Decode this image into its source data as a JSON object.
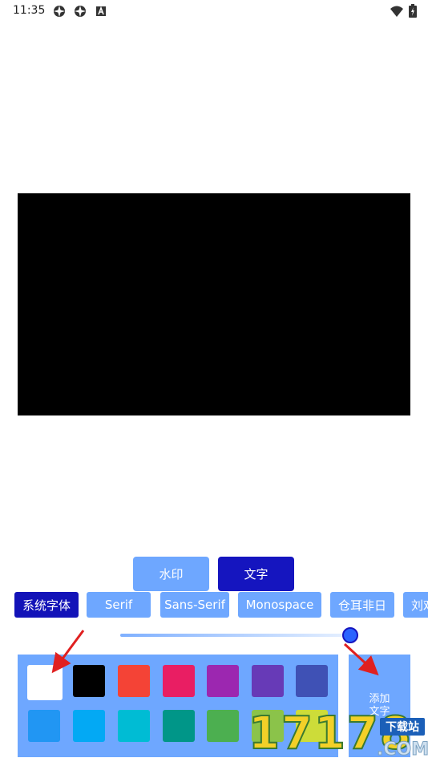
{
  "status_bar": {
    "time": "11:35"
  },
  "tabs": [
    {
      "label": "水印"
    },
    {
      "label": "文字"
    }
  ],
  "fonts": [
    {
      "label": "系统字体",
      "selected": true
    },
    {
      "label": "Serif"
    },
    {
      "label": "Sans-Serif"
    },
    {
      "label": "Monospace"
    },
    {
      "label": "仓耳非日"
    },
    {
      "label": "刘戏"
    }
  ],
  "size_slider": {
    "value_fraction": 1.0
  },
  "colors": {
    "row1": [
      "#ffffff",
      "#000000",
      "#f44336",
      "#e91e63",
      "#9c27b0",
      "#673ab7",
      "#3f51b5"
    ],
    "row2": [
      "#2196f3",
      "#03a9f4",
      "#00bcd4",
      "#009688",
      "#4caf50",
      "#8bc34a",
      "#cddc39"
    ],
    "accent": "#6ea7ff",
    "selected_tab": "#1515bf"
  },
  "add_button": {
    "label_line1": "添加",
    "label_line2": "文字"
  },
  "watermark": {
    "digits": "17178",
    "badge": "下载站",
    "domain": ".COM"
  }
}
